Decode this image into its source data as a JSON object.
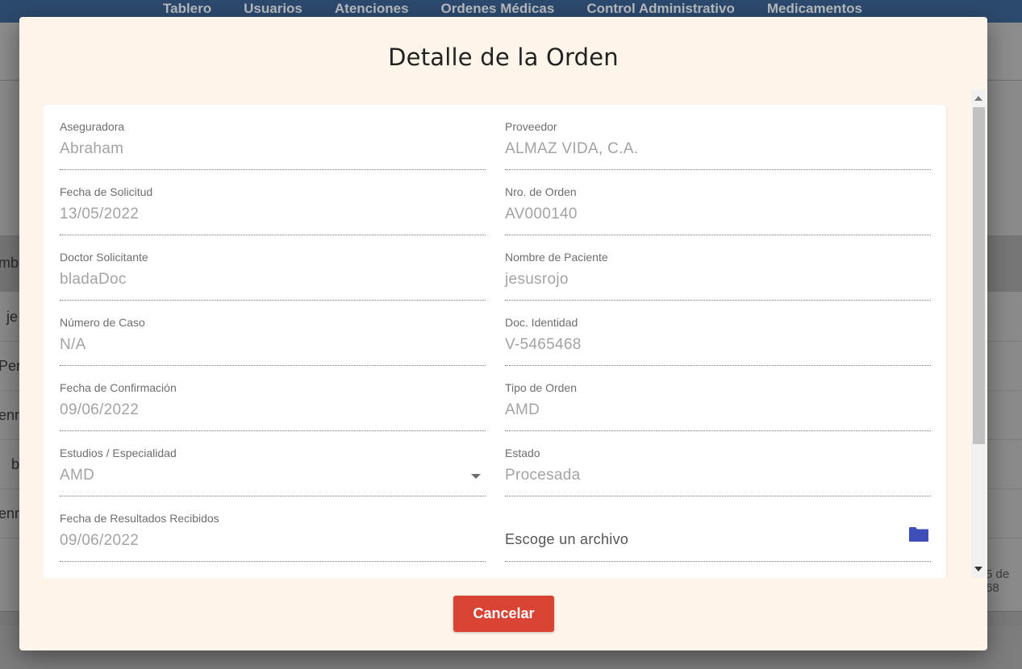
{
  "nav": {
    "items": [
      "Tablero",
      "Usuarios",
      "Atenciones",
      "Ordenes Médicas",
      "Control Administrativo",
      "Medicamentos"
    ]
  },
  "background": {
    "column_header_fragment": "mb",
    "rows": [
      "je",
      "Per",
      "enr",
      "b",
      "enr"
    ],
    "pager_fragment": "5 de 68"
  },
  "modal": {
    "title": "Detalle de la Orden",
    "cancel_label": "Cancelar",
    "fields": {
      "aseguradora": {
        "label": "Aseguradora",
        "value": "Abraham"
      },
      "proveedor": {
        "label": "Proveedor",
        "value": "ALMAZ VIDA, C.A."
      },
      "fecha_solicitud": {
        "label": "Fecha de Solicitud",
        "value": "13/05/2022"
      },
      "nro_orden": {
        "label": "Nro. de Orden",
        "value": "AV000140"
      },
      "doctor": {
        "label": "Doctor Solicitante",
        "value": "bladaDoc"
      },
      "paciente": {
        "label": "Nombre de Paciente",
        "value": "jesusrojo"
      },
      "numero_caso": {
        "label": "Número de Caso",
        "value": "N/A"
      },
      "doc_identidad": {
        "label": "Doc. Identidad",
        "value": "V-5465468"
      },
      "fecha_confirmacion": {
        "label": "Fecha de Confirmación",
        "value": "09/06/2022"
      },
      "tipo_orden": {
        "label": "Tipo de Orden",
        "value": "AMD"
      },
      "estudios": {
        "label": "Estudios / Especialidad",
        "value": "AMD"
      },
      "estado": {
        "label": "Estado",
        "value": "Procesada"
      },
      "fecha_resultados": {
        "label": "Fecha de Resultados Recibidos",
        "value": "09/06/2022"
      },
      "archivo": {
        "placeholder": "Escoge un archivo",
        "icon": "folder-icon",
        "icon_color": "#3f4db8"
      }
    }
  },
  "colors": {
    "nav_bg": "#2c4a6e",
    "modal_bg": "#fdf5ea",
    "cancel_bg": "#d84333"
  }
}
